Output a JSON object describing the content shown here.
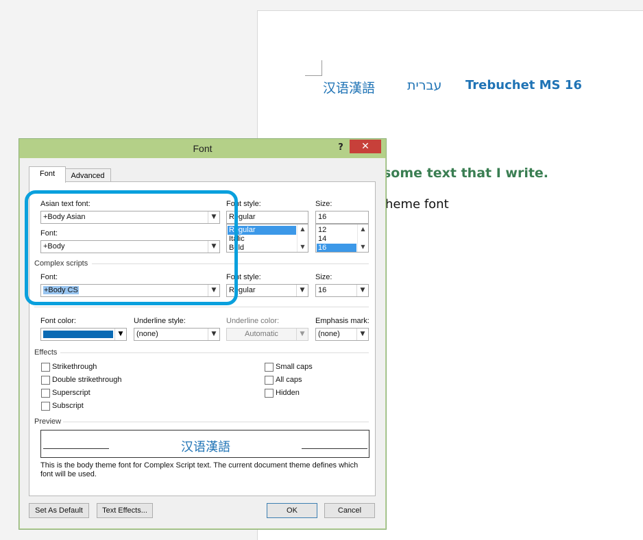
{
  "document": {
    "line1": {
      "asian": "汉语漢語",
      "hebrew": "עברית",
      "latin": "Trebuchet MS 16"
    },
    "green_text": "some text that I write.",
    "body_text": "heme font"
  },
  "dialog": {
    "title": "Font",
    "help_label": "?",
    "close_label": "✕",
    "tabs": [
      {
        "label": "Font",
        "active": true
      },
      {
        "label": "Advanced",
        "active": false
      }
    ],
    "latin_text": {
      "asian_font_label": "Asian text font:",
      "asian_font_value": "+Body Asian",
      "font_label": "Font:",
      "font_value": "+Body",
      "style_label": "Font style:",
      "style_value": "Regular",
      "style_options": [
        "Regular",
        "Italic",
        "Bold"
      ],
      "size_label": "Size:",
      "size_value": "16",
      "size_options": [
        "12",
        "14",
        "16"
      ]
    },
    "complex_scripts": {
      "group_label": "Complex scripts",
      "font_label": "Font:",
      "font_value": "+Body CS",
      "style_label": "Font style:",
      "style_value": "Regular",
      "size_label": "Size:",
      "size_value": "16"
    },
    "all_text": {
      "font_color_label": "Font color:",
      "font_color": "#0a6ab4",
      "underline_style_label": "Underline style:",
      "underline_style_value": "(none)",
      "underline_color_label": "Underline color:",
      "underline_color_value": "Automatic",
      "emphasis_label": "Emphasis mark:",
      "emphasis_value": "(none)"
    },
    "effects": {
      "group_label": "Effects",
      "left": [
        "Strikethrough",
        "Double strikethrough",
        "Superscript",
        "Subscript"
      ],
      "right": [
        "Small caps",
        "All caps",
        "Hidden"
      ]
    },
    "preview": {
      "group_label": "Preview",
      "sample": "汉语漢語",
      "note": "This is the body theme font for Complex Script text. The current document theme defines which font will be used."
    },
    "buttons": {
      "set_default": "Set As Default",
      "text_effects": "Text Effects...",
      "ok": "OK",
      "cancel": "Cancel"
    }
  },
  "colors": {
    "highlight": "#0aa0dd",
    "titlebar": "#b4d088",
    "close": "#c7403a",
    "doc_blue": "#1f73b5",
    "doc_green": "#3a7e52"
  }
}
